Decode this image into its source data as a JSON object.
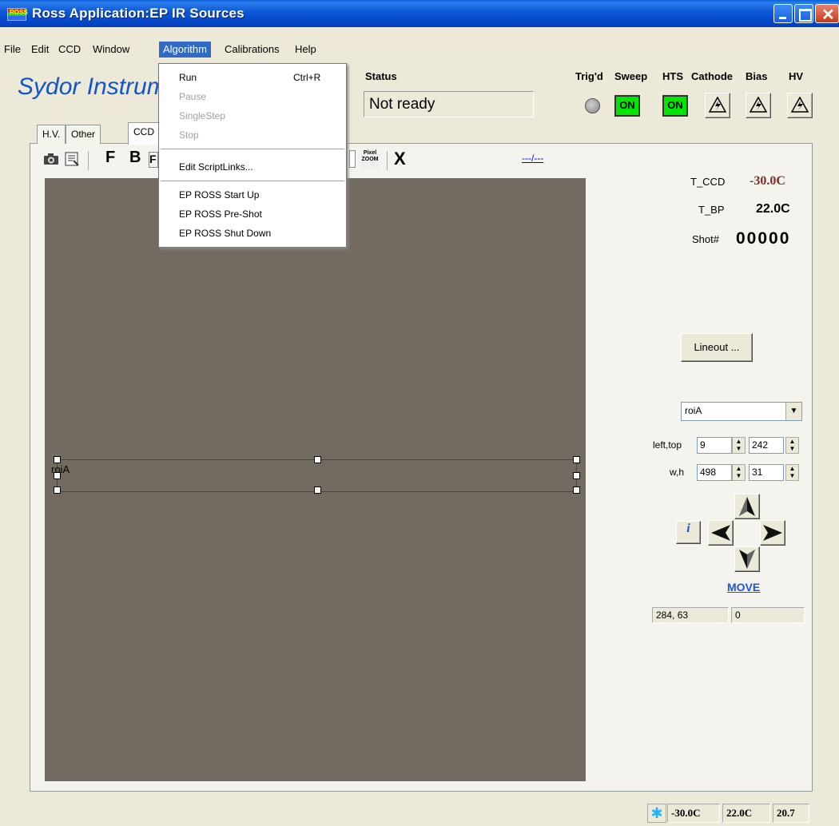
{
  "window": {
    "title": "Ross Application:EP IR Sources",
    "icon_text": "ROSS"
  },
  "menubar": {
    "items": [
      {
        "label": "File"
      },
      {
        "label": "Edit"
      },
      {
        "label": "CCD"
      },
      {
        "label": "Window"
      },
      {
        "label": "Algorithm",
        "active": true
      },
      {
        "label": "Calibrations"
      },
      {
        "label": "Help"
      }
    ]
  },
  "algorithm_menu": {
    "run": "Run",
    "run_shortcut": "Ctrl+R",
    "pause": "Pause",
    "single_step": "SingleStep",
    "stop": "Stop",
    "edit_scriptlinks": "Edit ScriptLinks...",
    "start_up": "EP ROSS Start Up",
    "pre_shot": "EP ROSS Pre-Shot",
    "shut_down": "EP ROSS Shut Down"
  },
  "header": {
    "logo": "Sydor Instrum",
    "status_label": "Status",
    "status_value": "Not ready",
    "trigd_label": "Trig'd",
    "sweep_label": "Sweep",
    "hts_label": "HTS",
    "cathode_label": "Cathode",
    "bias_label": "Bias",
    "hv_label": "HV",
    "sweep_state": "ON",
    "hts_state": "ON"
  },
  "tabs": [
    {
      "label": "H.V."
    },
    {
      "label": "Other"
    },
    {
      "label": "CCD",
      "active": true
    }
  ],
  "toolbar": {
    "f_label": "F",
    "b_label": "B",
    "partial_label": "F",
    "pixel_zoom_line1": "Pixel",
    "pixel_zoom_line2": "ZOOM",
    "x_label": "X",
    "link_text": "---/---"
  },
  "image": {
    "roi_label": "roiA"
  },
  "right_panel": {
    "t_ccd_label": "T_CCD",
    "t_ccd_value": "-30.0C",
    "t_bp_label": "T_BP",
    "t_bp_value": "22.0C",
    "shot_label": "Shot#",
    "shot_value": "00000",
    "lineout_label": "Lineout ...",
    "roi_selected": "roiA",
    "left_top_label": "left,top",
    "left_value": "9",
    "top_value": "242",
    "wh_label": "w,h",
    "w_value": "498",
    "h_value": "31",
    "info_label": "i",
    "move_label": "MOVE",
    "coord_readout": "284, 63",
    "value_readout": "0"
  },
  "statusbar": {
    "t_ccd": "-30.0C",
    "t_bp": "22.0C",
    "value": "20.7"
  },
  "colors": {
    "titlebar": "#0a5fd8",
    "on_indicator": "#00e600",
    "image_bg": "#736b61",
    "roi_border": "#7a1f7a",
    "t_ccd_value": "#7a2f2f",
    "logo": "#1155cc",
    "move_link": "#1f54e0"
  }
}
